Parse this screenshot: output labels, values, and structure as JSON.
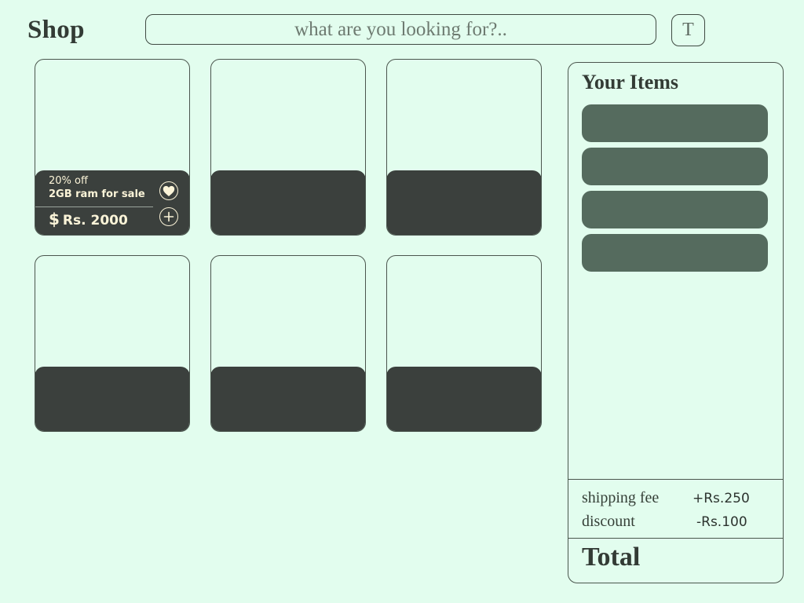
{
  "header": {
    "logo": "Shop",
    "search_placeholder": "what are you looking for?..",
    "theme_button": "T"
  },
  "products": [
    {
      "discount": "20% off",
      "name": "2GB ram for sale",
      "currency": "$",
      "price": "Rs. 2000"
    },
    {},
    {},
    {},
    {},
    {}
  ],
  "cart": {
    "title": "Your Items",
    "item_count": 4,
    "shipping_label": "shipping fee",
    "shipping_value": "+Rs.250",
    "discount_label": "discount",
    "discount_value": "-Rs.100",
    "total_label": "Total"
  },
  "icons": {
    "like": "heart-icon",
    "add": "plus-icon"
  },
  "colors": {
    "background": "#e2fdee",
    "card_bar": "#3b403d",
    "cart_slot": "#556b5e",
    "card_text": "#fbf4d8"
  }
}
